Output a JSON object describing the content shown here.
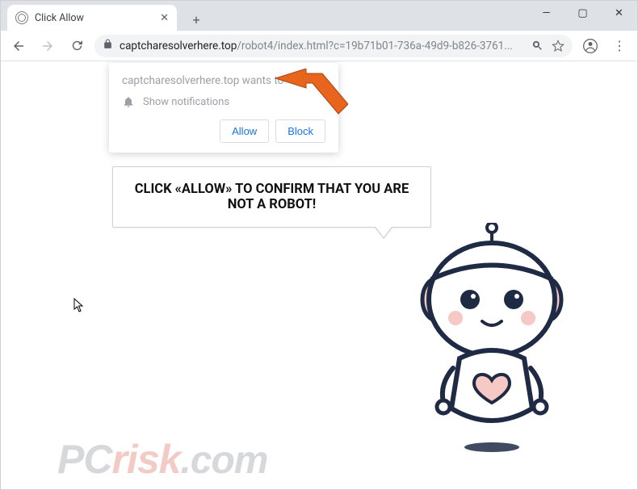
{
  "window": {
    "minimize": "—",
    "maximize": "▢",
    "close": "✕"
  },
  "tab": {
    "title": "Click Allow",
    "close": "✕",
    "newtab": "+"
  },
  "toolbar": {
    "back": "←",
    "forward": "→",
    "reload": "⟳",
    "lock": "🔒",
    "url_host": "captcharesolverhere.top",
    "url_path": "/robot4/index.html?c=19b71b01-736a-49d9-b826-3761...",
    "search_icon": "⌕",
    "star": "☆",
    "profile": "👤",
    "menu": "⋮"
  },
  "permission": {
    "title": "captcharesolverhere.top wants to",
    "item": "Show notifications",
    "allow": "Allow",
    "block": "Block",
    "close": "✕"
  },
  "speech": {
    "text": "CLICK «ALLOW» TO CONFIRM THAT YOU ARE NOT A ROBOT!"
  },
  "watermark": {
    "p": "P",
    "c": "C",
    "risk": "risk",
    "dom": ".com"
  },
  "colors": {
    "accent": "#1a73e8",
    "arrow": "#e8651e",
    "robot_outline": "#1f2a44",
    "robot_pink": "#f6c9c5"
  }
}
